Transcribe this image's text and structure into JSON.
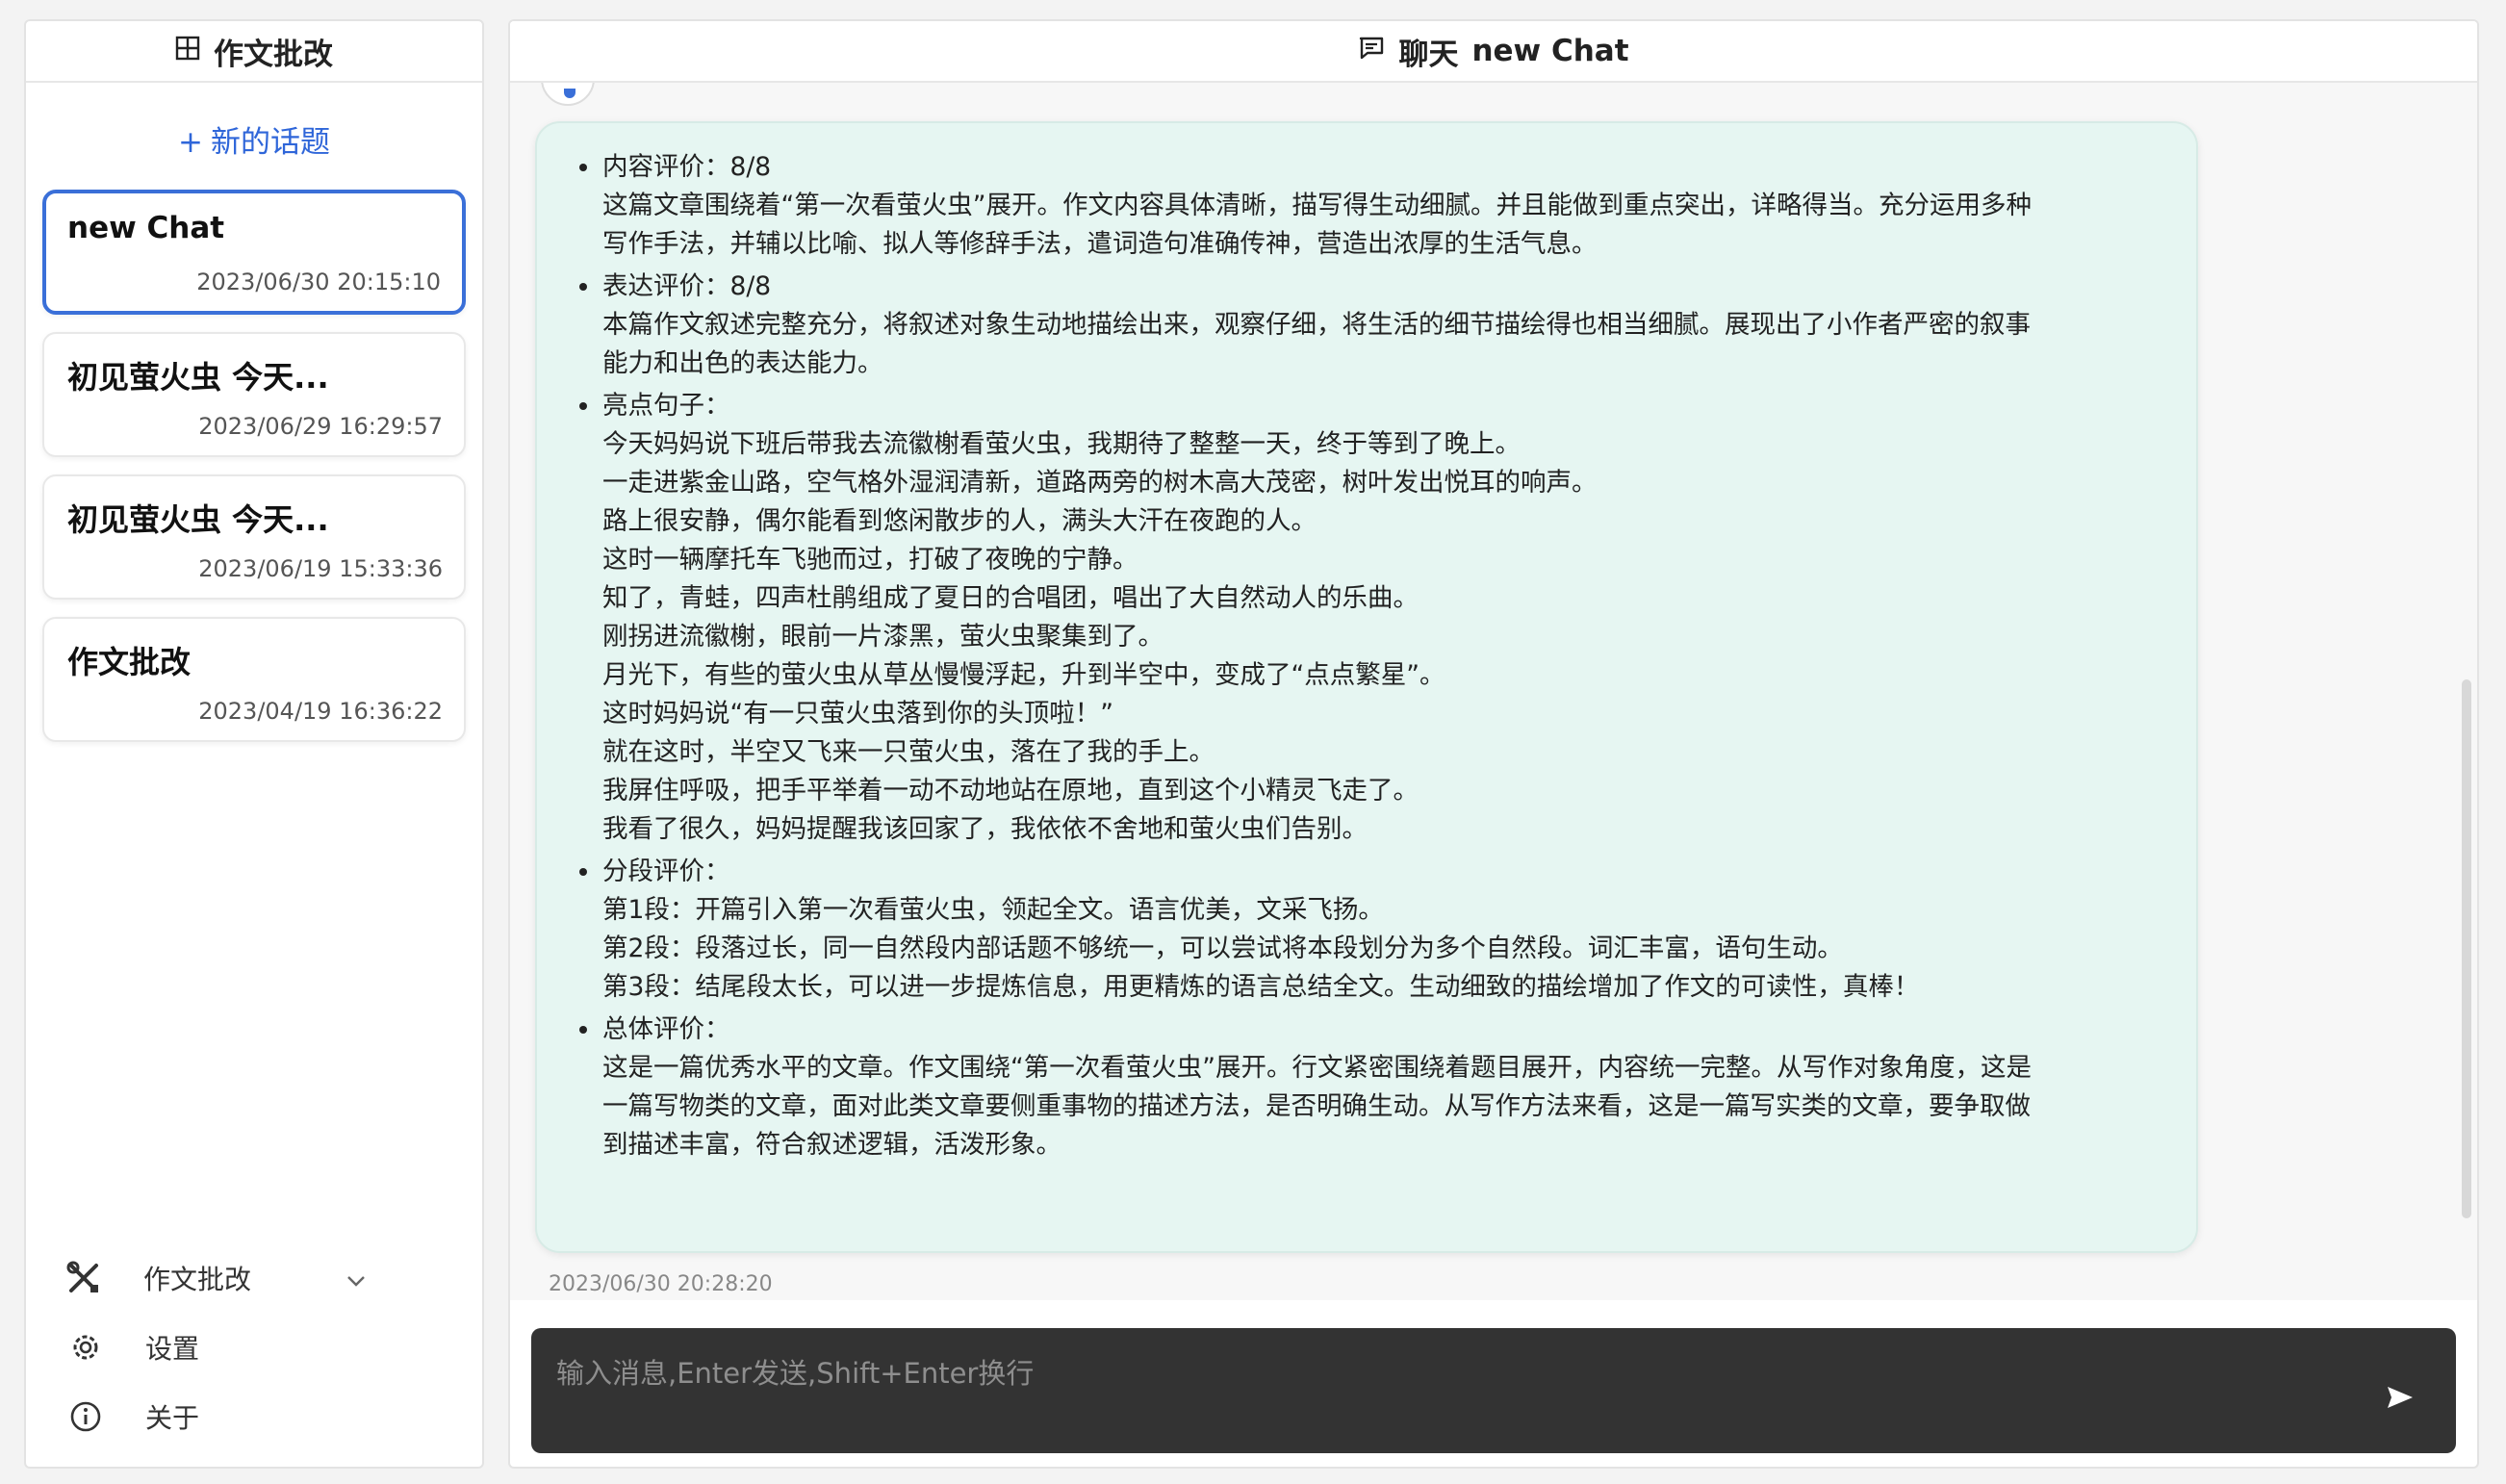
{
  "sidebar": {
    "title": "作文批改",
    "new_topic": "新的话题",
    "conversations": [
      {
        "title": "new Chat",
        "time": "2023/06/30 20:15:10"
      },
      {
        "title": "初见萤火虫 今天...",
        "time": "2023/06/29 16:29:57"
      },
      {
        "title": "初见萤火虫 今天...",
        "time": "2023/06/19 15:33:36"
      },
      {
        "title": "作文批改",
        "time": "2023/04/19 16:36:22"
      }
    ],
    "tools": {
      "mode": "作文批改",
      "settings": "设置",
      "about": "关于"
    }
  },
  "header": {
    "label": "聊天",
    "chat_name": "new Chat"
  },
  "message": {
    "time": "2023/06/30 20:28:20",
    "sections": [
      {
        "lines": [
          "内容评价：8/8",
          "这篇文章围绕着“第一次看萤火虫”展开。作文内容具体清晰，描写得生动细腻。并且能做到重点突出，详略得当。充分运用多种",
          "写作手法，并辅以比喻、拟人等修辞手法，遣词造句准确传神，营造出浓厚的生活气息。"
        ]
      },
      {
        "lines": [
          "表达评价：8/8",
          "本篇作文叙述完整充分，将叙述对象生动地描绘出来，观察仔细，将生活的细节描绘得也相当细腻。展现出了小作者严密的叙事",
          "能力和出色的表达能力。"
        ]
      },
      {
        "lines": [
          "亮点句子：",
          "今天妈妈说下班后带我去流徽榭看萤火虫，我期待了整整一天，终于等到了晚上。",
          "一走进紫金山路，空气格外湿润清新，道路两旁的树木高大茂密，树叶发出悦耳的响声。",
          "路上很安静，偶尔能看到悠闲散步的人，满头大汗在夜跑的人。",
          "这时一辆摩托车飞驰而过，打破了夜晚的宁静。",
          "知了，青蛙，四声杜鹃组成了夏日的合唱团，唱出了大自然动人的乐曲。",
          "刚拐进流徽榭，眼前一片漆黑，萤火虫聚集到了。",
          "月光下，有些的萤火虫从草丛慢慢浮起，升到半空中，变成了“点点繁星”。",
          "这时妈妈说“有一只萤火虫落到你的头顶啦！”",
          "就在这时，半空又飞来一只萤火虫，落在了我的手上。",
          "我屏住呼吸，把手平举着一动不动地站在原地，直到这个小精灵飞走了。",
          "我看了很久，妈妈提醒我该回家了，我依依不舍地和萤火虫们告别。"
        ]
      },
      {
        "lines": [
          "分段评价：",
          "第1段：开篇引入第一次看萤火虫，领起全文。语言优美，文采飞扬。",
          "第2段：段落过长，同一自然段内部话题不够统一，可以尝试将本段划分为多个自然段。词汇丰富，语句生动。",
          "第3段：结尾段太长，可以进一步提炼信息，用更精炼的语言总结全文。生动细致的描绘增加了作文的可读性，真棒！"
        ]
      },
      {
        "lines": [
          "总体评价：",
          "这是一篇优秀水平的文章。作文围绕“第一次看萤火虫”展开。行文紧密围绕着题目展开，内容统一完整。从写作对象角度，这是",
          "一篇写物类的文章，面对此类文章要侧重事物的描述方法，是否明确生动。从写作方法来看，这是一篇写实类的文章，要争取做",
          "到描述丰富，符合叙述逻辑，活泼形象。"
        ]
      }
    ]
  },
  "input": {
    "placeholder": "输入消息,Enter发送,Shift+Enter换行"
  },
  "colors": {
    "accent": "#3a6fd8",
    "bubble_bg": "#e6f6f2",
    "input_bg": "#333333"
  },
  "icons": {
    "sidebar_title": "grid-icon",
    "header": "chat-bubble-icon",
    "tools": "tools-icon",
    "settings": "gear-icon",
    "about": "info-icon",
    "send": "send-icon"
  }
}
